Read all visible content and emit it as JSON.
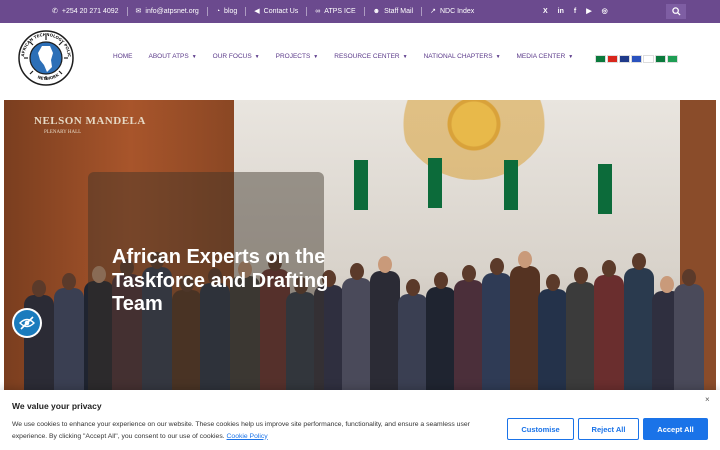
{
  "topbar": {
    "links": [
      {
        "icon": "phone-icon",
        "glyph": "✆",
        "label": "+254 20 271 4092"
      },
      {
        "icon": "envelope-icon",
        "glyph": "✉",
        "label": "info@atpsnet.org"
      },
      {
        "icon": "rss-icon",
        "glyph": "◔",
        "label": "blog"
      },
      {
        "icon": "megaphone-icon",
        "glyph": "◀",
        "label": "Contact Us"
      },
      {
        "icon": "link-icon",
        "glyph": "∞",
        "label": "ATPS ICE"
      },
      {
        "icon": "users-icon",
        "glyph": "☻",
        "label": "Staff Mail"
      },
      {
        "icon": "chart-line-icon",
        "glyph": "↗",
        "label": "NDC Index"
      }
    ],
    "social": [
      {
        "icon": "x-twitter-icon",
        "glyph": "X"
      },
      {
        "icon": "linkedin-icon",
        "glyph": "in"
      },
      {
        "icon": "facebook-icon",
        "glyph": "f"
      },
      {
        "icon": "youtube-icon",
        "glyph": "▶"
      },
      {
        "icon": "instagram-icon",
        "glyph": "◎"
      }
    ],
    "colors": {
      "bar": "#6b4a8e",
      "search": "#7e5ea3"
    }
  },
  "logo": {
    "text_top": "AFRICAN TECHNOLOGY POLICY STUDIES",
    "text_bottom": "NETWORK"
  },
  "nav": {
    "items": [
      {
        "label": "HOME",
        "dropdown": false
      },
      {
        "label": "ABOUT ATPS",
        "dropdown": true
      },
      {
        "label": "OUR FOCUS",
        "dropdown": true
      },
      {
        "label": "PROJECTS",
        "dropdown": true
      },
      {
        "label": "RESOURCE CENTER",
        "dropdown": true
      },
      {
        "label": "NATIONAL CHAPTERS",
        "dropdown": true
      },
      {
        "label": "MEDIA CENTER",
        "dropdown": true
      }
    ],
    "color": "#5b3a8a"
  },
  "languages": [
    {
      "name": "Arabic",
      "color": "#0a7a3c"
    },
    {
      "name": "Chinese",
      "color": "#d8261c"
    },
    {
      "name": "English",
      "color": "#1f3a8a"
    },
    {
      "name": "French",
      "color": "#2a52be"
    },
    {
      "name": "Japanese",
      "color": "#ffffff"
    },
    {
      "name": "Portuguese",
      "color": "#0a7a3c"
    },
    {
      "name": "Swahili",
      "color": "#1e9e54"
    }
  ],
  "hero": {
    "sign_line1": "NELSON MANDELA",
    "sign_line2": "PLENARY HALL",
    "title": "African Experts on the Taskforce and Drafting Team"
  },
  "cookie": {
    "title": "We value your privacy",
    "text": "We use cookies to enhance your experience on our website. These cookies help us improve site performance, functionality, and ensure a seamless user experience. By clicking \"Accept All\", you consent to our use of cookies.",
    "link": "Cookie Policy",
    "close": "×",
    "customise": "Customise",
    "reject": "Reject All",
    "accept": "Accept All",
    "accent": "#1a73e8"
  }
}
